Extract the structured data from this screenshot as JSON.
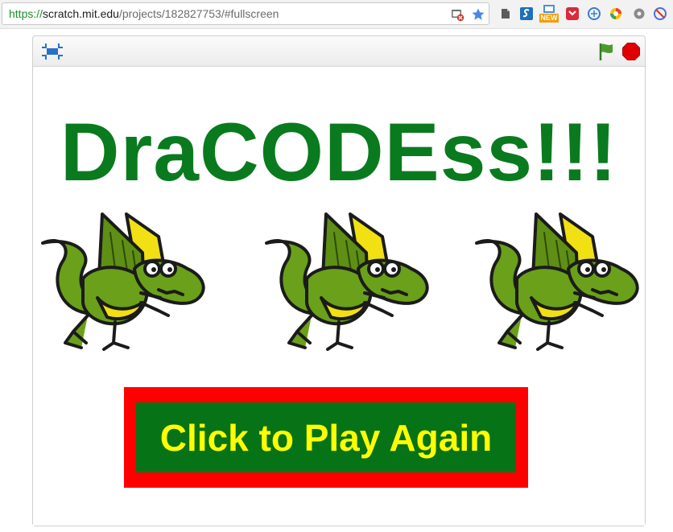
{
  "browser": {
    "url_scheme": "https://",
    "url_host": "scratch.mit.edu",
    "url_path": "/projects/182827753/#fullscreen",
    "extensions": [
      "evernote-icon",
      "s-extension-icon",
      "new-extension-icon",
      "pocket-icon",
      "sync-icon",
      "color-extension-icon",
      "gear-extension-icon",
      "block-icon"
    ],
    "new_badge": "NEW"
  },
  "player": {
    "controls": {
      "fullscreen_toggle": "exit-fullscreen-icon",
      "green_flag": "green-flag-icon",
      "stop": "stop-icon"
    },
    "stage": {
      "title": "DraCODEss!!!",
      "play_again_label": "Click to Play Again",
      "dragon_count": 3
    }
  },
  "colors": {
    "title": "#0a7a1f",
    "button_border": "#ff0000",
    "button_fill": "#067316",
    "button_text": "#ffff00",
    "dragon_body": "#6aa01a",
    "dragon_wing_yellow": "#f0e014"
  }
}
